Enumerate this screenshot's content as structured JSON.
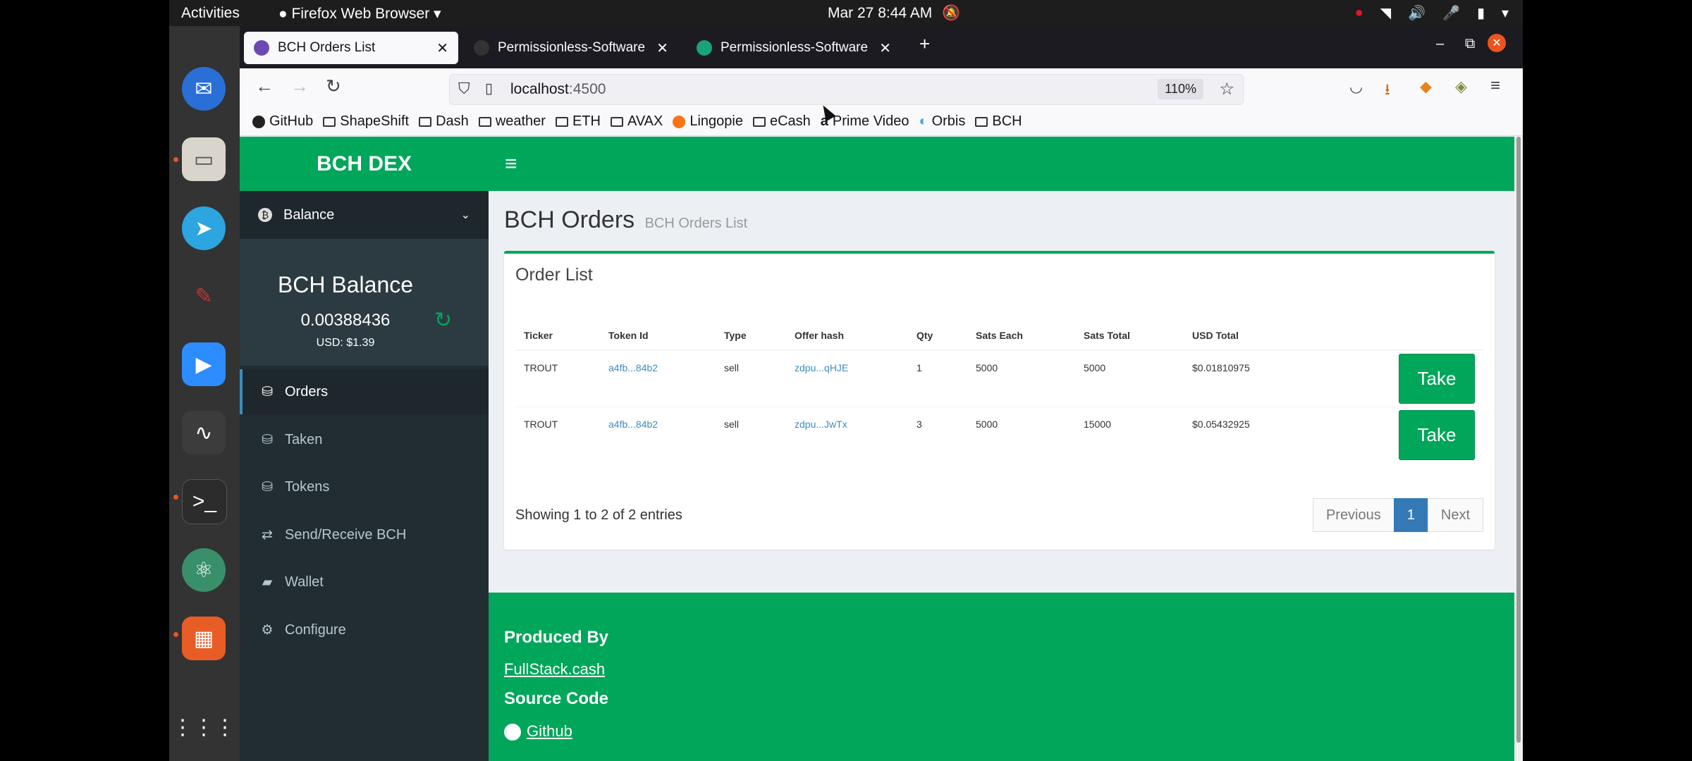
{
  "topbar": {
    "activities": "Activities",
    "app": "Firefox Web Browser",
    "datetime": "Mar 27  8:44 AM"
  },
  "browser": {
    "tabs": [
      {
        "label": "BCH Orders List"
      },
      {
        "label": "Permissionless-Software"
      },
      {
        "label": "Permissionless-Software"
      }
    ],
    "url_host": "localhost",
    "url_port": ":4500",
    "zoom": "110%",
    "bookmarks": [
      "GitHub",
      "ShapeShift",
      "Dash",
      "weather",
      "ETH",
      "AVAX",
      "Lingopie",
      "eCash",
      "Prime Video",
      "Orbis",
      "BCH"
    ]
  },
  "app": {
    "logo": "BCH DEX",
    "sidebar": {
      "balance_header": "Balance",
      "balance_title": "BCH Balance",
      "balance_value": "0.00388436",
      "balance_usd": "USD: $1.39",
      "menu": [
        "Orders",
        "Taken",
        "Tokens",
        "Send/Receive BCH",
        "Wallet",
        "Configure"
      ]
    },
    "page_title": "BCH Orders",
    "page_subtitle": "BCH Orders List",
    "box_title": "Order List",
    "table": {
      "headers": [
        "Ticker",
        "Token Id",
        "Type",
        "Offer hash",
        "Qty",
        "Sats Each",
        "Sats Total",
        "USD Total"
      ],
      "rows": [
        {
          "ticker": "TROUT",
          "token_id": "a4fb...84b2",
          "type": "sell",
          "offer_hash": "zdpu...qHJE",
          "qty": "1",
          "sats_each": "5000",
          "sats_total": "5000",
          "usd_total": "$0.01810975",
          "action": "Take"
        },
        {
          "ticker": "TROUT",
          "token_id": "a4fb...84b2",
          "type": "sell",
          "offer_hash": "zdpu...JwTx",
          "qty": "3",
          "sats_each": "5000",
          "sats_total": "15000",
          "usd_total": "$0.05432925",
          "action": "Take"
        }
      ]
    },
    "entries_info": "Showing 1 to 2 of 2 entries",
    "pagination": {
      "previous": "Previous",
      "page": "1",
      "next": "Next"
    },
    "footer": {
      "produced_by": "Produced By",
      "produced_link": "FullStack.cash",
      "source_code": "Source Code",
      "source_link": "Github"
    }
  }
}
